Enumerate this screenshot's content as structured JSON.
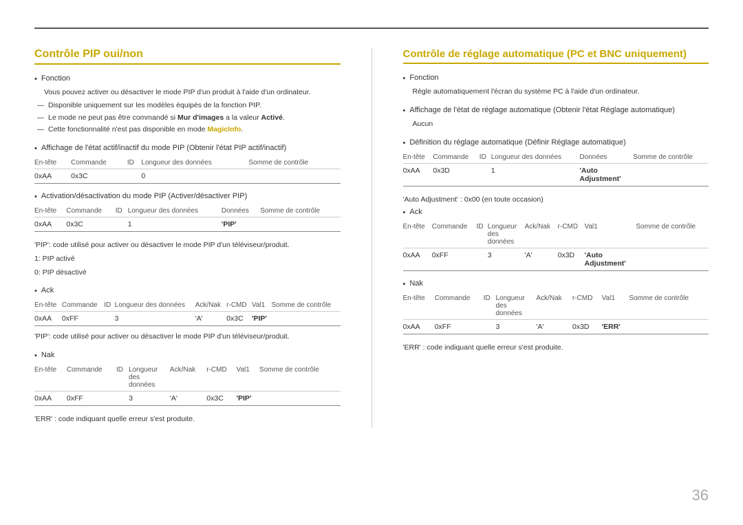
{
  "page": {
    "number": "36",
    "top_border": true
  },
  "left_section": {
    "title": "Contrôle PIP oui/non",
    "function_label": "Fonction",
    "function_desc": "Vous pouvez activer ou désactiver le mode PIP d'un produit à l'aide d'un ordinateur.",
    "note1": "Disponible uniquement sur les modèles équipés de la fonction PIP.",
    "note2_part1": "Le mode ne peut pas être commandé si ",
    "note2_bold": "Mur d'images",
    "note2_part2": " a la valeur ",
    "note2_active": "Activé",
    "note2_part3": ".",
    "note3_part1": "Cette fonctionnalité n'est pas disponible en mode ",
    "note3_magic": "MagicInfo",
    "note3_part2": ".",
    "state_label": "Affichage de l'état actif/inactif du mode PIP (Obtenir l'état PIP actif/inactif)",
    "table1": {
      "headers": [
        "En-tête",
        "Commande",
        "ID",
        "Longueur des données",
        "Somme de contrôle"
      ],
      "rows": [
        [
          "0xAA",
          "0x3C",
          "",
          "0",
          ""
        ]
      ]
    },
    "activate_label": "Activation/désactivation du mode PIP (Activer/désactiver PIP)",
    "table2": {
      "headers": [
        "En-tête",
        "Commande",
        "ID",
        "Longueur des données",
        "Données",
        "Somme de contrôle"
      ],
      "rows": [
        [
          "0xAA",
          "0x3C",
          "",
          "1",
          "'PIP'",
          ""
        ]
      ]
    },
    "pip_note1": "'PIP': code utilisé pour activer ou désactiver le mode PIP d'un téléviseur/produit.",
    "pip_1": "1: PIP activé",
    "pip_0": "0: PIP désactivé",
    "ack_label": "Ack",
    "table3": {
      "headers": [
        "En-tête",
        "Commande",
        "ID",
        "Longueur des données",
        "Ack/Nak",
        "r-CMD",
        "Val1",
        "Somme de contrôle"
      ],
      "rows": [
        [
          "0xAA",
          "0xFF",
          "",
          "3",
          "'A'",
          "0x3C",
          "'PIP'",
          ""
        ]
      ]
    },
    "pip_note2": "'PIP': code utilisé pour activer ou désactiver le mode PIP d'un téléviseur/produit.",
    "nak_label": "Nak",
    "table4": {
      "headers": [
        "En-tête",
        "Commande",
        "ID",
        "Longueur des données",
        "Ack/Nak",
        "r-CMD",
        "Val1",
        "Somme de contrôle"
      ],
      "rows": [
        [
          "0xAA",
          "0xFF",
          "",
          "3",
          "'A'",
          "0x3C",
          "'PIP'",
          ""
        ]
      ]
    },
    "err_note": "'ERR' : code indiquant quelle erreur s'est produite."
  },
  "right_section": {
    "title": "Contrôle de réglage automatique (PC et BNC uniquement)",
    "function_label": "Fonction",
    "function_desc": "Règle automatiquement l'écran du système PC à l'aide d'un ordinateur.",
    "display_label": "Affichage de l'état de réglage automatique (Obtenir l'état Réglage automatique)",
    "display_value": "Aucun",
    "define_label": "Définition du réglage automatique (Définir Réglage automatique)",
    "table1": {
      "headers": [
        "En-tête",
        "Commande",
        "ID",
        "Longueur des données",
        "Données",
        "Somme de contrôle"
      ],
      "rows": [
        [
          "0xAA",
          "0x3D",
          "",
          "1",
          "'Auto Adjustment'",
          ""
        ]
      ]
    },
    "auto_adj_note": "'Auto Adjustment' : 0x00 (en toute occasion)",
    "ack_label": "Ack",
    "table2": {
      "headers": [
        "En-tête",
        "Commande",
        "ID",
        "Longueur des données",
        "Ack/Nak",
        "r-CMD",
        "Val1",
        "Somme de contrôle"
      ],
      "rows": [
        [
          "0xAA",
          "0xFF",
          "",
          "3",
          "'A'",
          "0x3D",
          "'Auto Adjustment'",
          ""
        ]
      ]
    },
    "nak_label": "Nak",
    "table3": {
      "headers": [
        "En-tête",
        "Commande",
        "ID",
        "Longueur des données",
        "Ack/Nak",
        "r-CMD",
        "Val1",
        "Somme de contrôle"
      ],
      "rows": [
        [
          "0xAA",
          "0xFF",
          "",
          "3",
          "'A'",
          "0x3D",
          "'ERR'",
          ""
        ]
      ]
    },
    "err_note": "'ERR' : code indiquant quelle erreur s'est produite."
  }
}
